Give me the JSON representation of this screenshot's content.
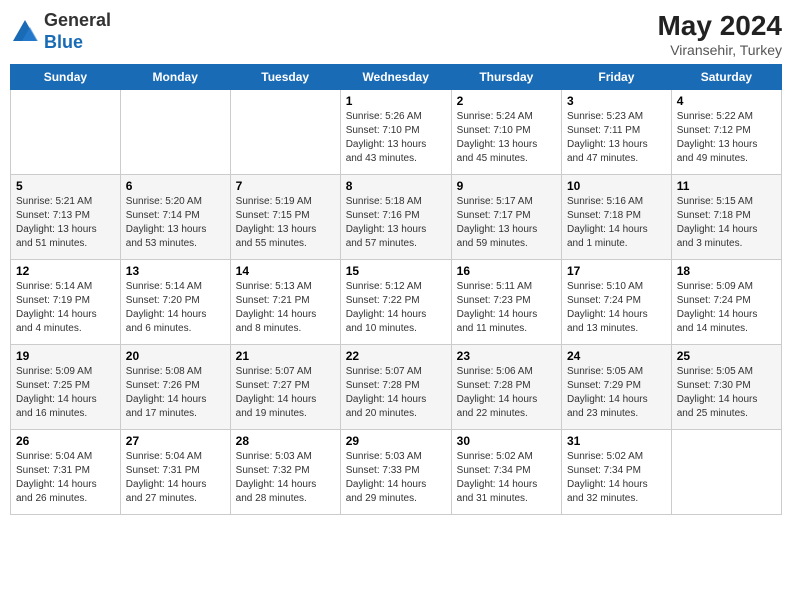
{
  "header": {
    "logo_line1": "General",
    "logo_line2": "Blue",
    "month_year": "May 2024",
    "location": "Viransehir, Turkey"
  },
  "weekdays": [
    "Sunday",
    "Monday",
    "Tuesday",
    "Wednesday",
    "Thursday",
    "Friday",
    "Saturday"
  ],
  "weeks": [
    [
      {
        "day": "",
        "info": ""
      },
      {
        "day": "",
        "info": ""
      },
      {
        "day": "",
        "info": ""
      },
      {
        "day": "1",
        "info": "Sunrise: 5:26 AM\nSunset: 7:10 PM\nDaylight: 13 hours\nand 43 minutes."
      },
      {
        "day": "2",
        "info": "Sunrise: 5:24 AM\nSunset: 7:10 PM\nDaylight: 13 hours\nand 45 minutes."
      },
      {
        "day": "3",
        "info": "Sunrise: 5:23 AM\nSunset: 7:11 PM\nDaylight: 13 hours\nand 47 minutes."
      },
      {
        "day": "4",
        "info": "Sunrise: 5:22 AM\nSunset: 7:12 PM\nDaylight: 13 hours\nand 49 minutes."
      }
    ],
    [
      {
        "day": "5",
        "info": "Sunrise: 5:21 AM\nSunset: 7:13 PM\nDaylight: 13 hours\nand 51 minutes."
      },
      {
        "day": "6",
        "info": "Sunrise: 5:20 AM\nSunset: 7:14 PM\nDaylight: 13 hours\nand 53 minutes."
      },
      {
        "day": "7",
        "info": "Sunrise: 5:19 AM\nSunset: 7:15 PM\nDaylight: 13 hours\nand 55 minutes."
      },
      {
        "day": "8",
        "info": "Sunrise: 5:18 AM\nSunset: 7:16 PM\nDaylight: 13 hours\nand 57 minutes."
      },
      {
        "day": "9",
        "info": "Sunrise: 5:17 AM\nSunset: 7:17 PM\nDaylight: 13 hours\nand 59 minutes."
      },
      {
        "day": "10",
        "info": "Sunrise: 5:16 AM\nSunset: 7:18 PM\nDaylight: 14 hours\nand 1 minute."
      },
      {
        "day": "11",
        "info": "Sunrise: 5:15 AM\nSunset: 7:18 PM\nDaylight: 14 hours\nand 3 minutes."
      }
    ],
    [
      {
        "day": "12",
        "info": "Sunrise: 5:14 AM\nSunset: 7:19 PM\nDaylight: 14 hours\nand 4 minutes."
      },
      {
        "day": "13",
        "info": "Sunrise: 5:14 AM\nSunset: 7:20 PM\nDaylight: 14 hours\nand 6 minutes."
      },
      {
        "day": "14",
        "info": "Sunrise: 5:13 AM\nSunset: 7:21 PM\nDaylight: 14 hours\nand 8 minutes."
      },
      {
        "day": "15",
        "info": "Sunrise: 5:12 AM\nSunset: 7:22 PM\nDaylight: 14 hours\nand 10 minutes."
      },
      {
        "day": "16",
        "info": "Sunrise: 5:11 AM\nSunset: 7:23 PM\nDaylight: 14 hours\nand 11 minutes."
      },
      {
        "day": "17",
        "info": "Sunrise: 5:10 AM\nSunset: 7:24 PM\nDaylight: 14 hours\nand 13 minutes."
      },
      {
        "day": "18",
        "info": "Sunrise: 5:09 AM\nSunset: 7:24 PM\nDaylight: 14 hours\nand 14 minutes."
      }
    ],
    [
      {
        "day": "19",
        "info": "Sunrise: 5:09 AM\nSunset: 7:25 PM\nDaylight: 14 hours\nand 16 minutes."
      },
      {
        "day": "20",
        "info": "Sunrise: 5:08 AM\nSunset: 7:26 PM\nDaylight: 14 hours\nand 17 minutes."
      },
      {
        "day": "21",
        "info": "Sunrise: 5:07 AM\nSunset: 7:27 PM\nDaylight: 14 hours\nand 19 minutes."
      },
      {
        "day": "22",
        "info": "Sunrise: 5:07 AM\nSunset: 7:28 PM\nDaylight: 14 hours\nand 20 minutes."
      },
      {
        "day": "23",
        "info": "Sunrise: 5:06 AM\nSunset: 7:28 PM\nDaylight: 14 hours\nand 22 minutes."
      },
      {
        "day": "24",
        "info": "Sunrise: 5:05 AM\nSunset: 7:29 PM\nDaylight: 14 hours\nand 23 minutes."
      },
      {
        "day": "25",
        "info": "Sunrise: 5:05 AM\nSunset: 7:30 PM\nDaylight: 14 hours\nand 25 minutes."
      }
    ],
    [
      {
        "day": "26",
        "info": "Sunrise: 5:04 AM\nSunset: 7:31 PM\nDaylight: 14 hours\nand 26 minutes."
      },
      {
        "day": "27",
        "info": "Sunrise: 5:04 AM\nSunset: 7:31 PM\nDaylight: 14 hours\nand 27 minutes."
      },
      {
        "day": "28",
        "info": "Sunrise: 5:03 AM\nSunset: 7:32 PM\nDaylight: 14 hours\nand 28 minutes."
      },
      {
        "day": "29",
        "info": "Sunrise: 5:03 AM\nSunset: 7:33 PM\nDaylight: 14 hours\nand 29 minutes."
      },
      {
        "day": "30",
        "info": "Sunrise: 5:02 AM\nSunset: 7:34 PM\nDaylight: 14 hours\nand 31 minutes."
      },
      {
        "day": "31",
        "info": "Sunrise: 5:02 AM\nSunset: 7:34 PM\nDaylight: 14 hours\nand 32 minutes."
      },
      {
        "day": "",
        "info": ""
      }
    ]
  ]
}
